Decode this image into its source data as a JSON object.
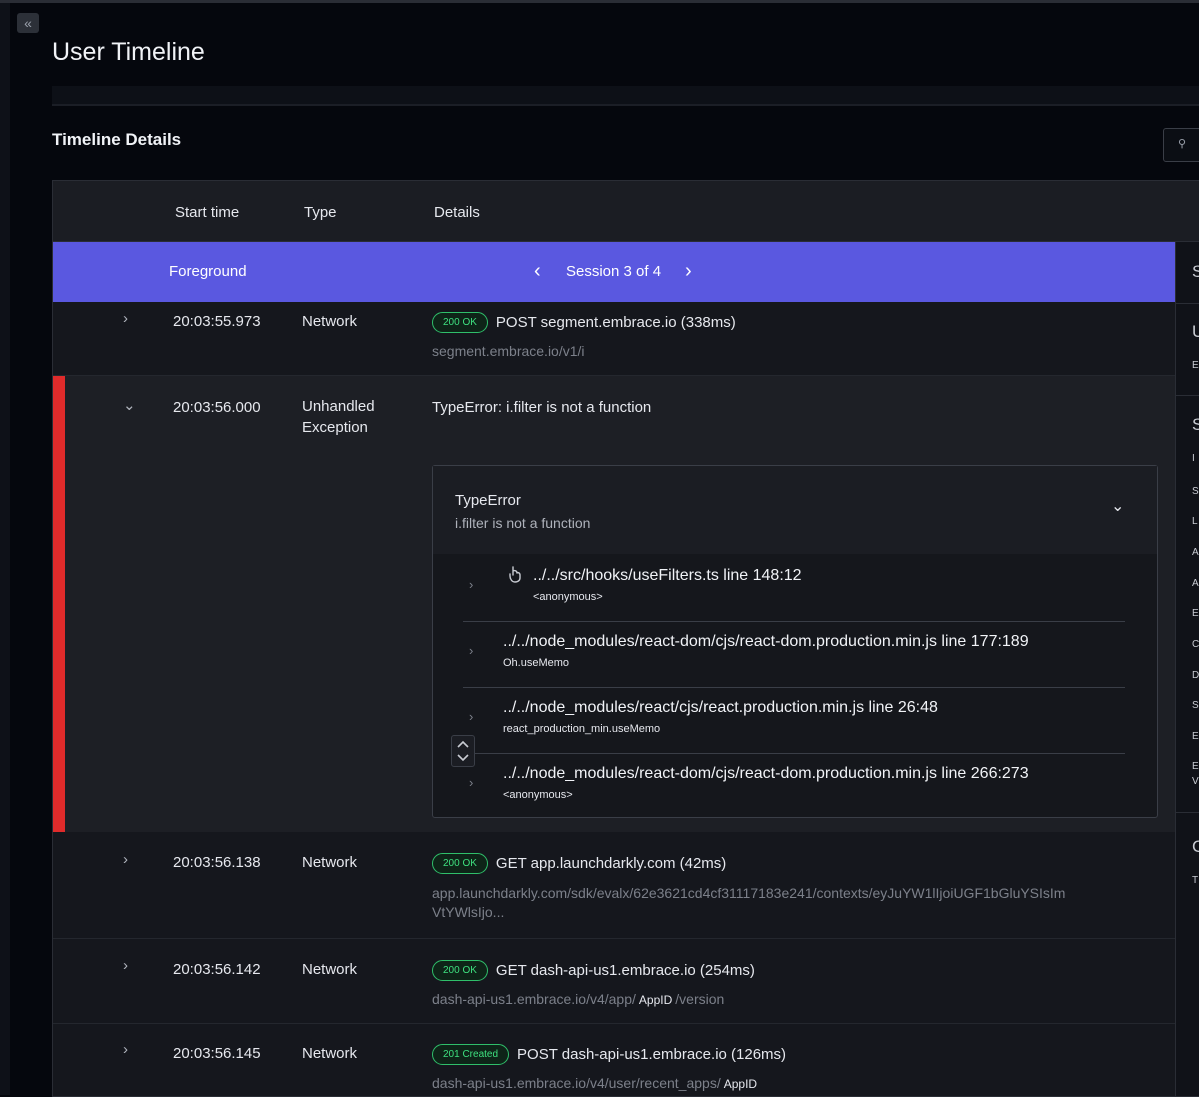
{
  "page": {
    "title": "User Timeline",
    "collapse_icon": "«"
  },
  "section": {
    "title": "Timeline Details",
    "search_icon": "⚲"
  },
  "table": {
    "columns": [
      "Start time",
      "Type",
      "Details"
    ]
  },
  "session": {
    "state": "Foreground",
    "label": "Session 3 of 4",
    "prev": "‹",
    "next": "›"
  },
  "rows": [
    {
      "chevron": "›",
      "time": "20:03:55.973",
      "type": "Network",
      "badge": "200 OK",
      "detail": "POST segment.embrace.io (338ms)",
      "url": "segment.embrace.io/v1/i"
    },
    {
      "chevron": "⌄",
      "time": "20:03:56.000",
      "type_line1": "Unhandled",
      "type_line2": "Exception",
      "detail": "TypeError: i.filter is not a function",
      "error": {
        "name": "TypeError",
        "message": "i.filter is not a function",
        "collapse": "⌄",
        "frames": [
          {
            "chevron": "›",
            "path": "../../src/hooks/useFilters.ts line 148:12",
            "sub": "<anonymous>"
          },
          {
            "chevron": "›",
            "path": "../../node_modules/react-dom/cjs/react-dom.production.min.js line 177:189",
            "sub": "Oh.useMemo"
          },
          {
            "chevron": "›",
            "path": "../../node_modules/react/cjs/react.production.min.js line 26:48",
            "sub": "react_production_min.useMemo"
          },
          {
            "chevron": "›",
            "path": "../../node_modules/react-dom/cjs/react-dom.production.min.js line 266:273",
            "sub": "<anonymous>"
          }
        ]
      }
    },
    {
      "chevron": "›",
      "time": "20:03:56.138",
      "type": "Network",
      "badge": "200 OK",
      "detail": "GET app.launchdarkly.com (42ms)",
      "url_line1": "app.launchdarkly.com/sdk/evalx/62e3621cd4cf31117183e241/contexts/eyJuYW1lIjoiUGF1bGluYSIsIm",
      "url_line2": "VtYWlsIjo..."
    },
    {
      "chevron": "›",
      "time": "20:03:56.142",
      "type": "Network",
      "badge": "200 OK",
      "detail": "GET dash-api-us1.embrace.io (254ms)",
      "url_prefix": "dash-api-us1.embrace.io/v4/app/",
      "url_token": "AppID",
      "url_suffix": "/version"
    },
    {
      "chevron": "›",
      "time": "20:03:56.145",
      "type": "Network",
      "badge": "201 Created",
      "detail": "POST dash-api-us1.embrace.io (126ms)",
      "url_prefix": "dash-api-us1.embrace.io/v4/user/recent_apps/",
      "url_token": "AppID"
    }
  ],
  "right_panel": {
    "letters": [
      "S",
      "U",
      "E",
      "S",
      "I",
      "S",
      "L",
      "A",
      "A",
      "E",
      "C",
      "D",
      "S",
      "E",
      "E",
      "V",
      "C",
      "T"
    ]
  },
  "colors": {
    "session_bar": "#5a58e0",
    "exception_bar": "#e02b2b",
    "ok_badge": "#2fbf6a"
  }
}
